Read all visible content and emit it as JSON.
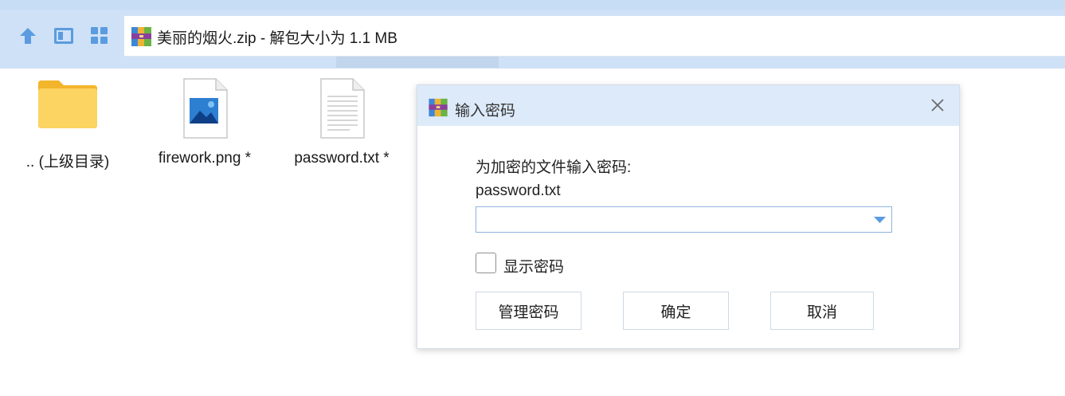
{
  "toolbar": {
    "nav_icons": [
      "up-arrow-icon",
      "view-icon",
      "grid-icon"
    ],
    "address_text": "美丽的烟火.zip - 解包大小为 1.1 MB",
    "archive_icon": "winrar-archive-icon"
  },
  "files": [
    {
      "name": ".. (上级目录)",
      "icon": "folder-icon"
    },
    {
      "name": "firework.png *",
      "icon": "image-file-icon"
    },
    {
      "name": "password.txt *",
      "icon": "text-file-icon"
    }
  ],
  "dialog": {
    "title": "输入密码",
    "prompt": "为加密的文件输入密码:",
    "filename": "password.txt",
    "password_value": "",
    "show_password_label": "显示密码",
    "show_password_checked": false,
    "buttons": {
      "manage": "管理密码",
      "ok": "确定",
      "cancel": "取消"
    }
  },
  "colors": {
    "toolbar_bg": "#cfe1f6",
    "dialog_title_bg": "#ddeafa",
    "accent": "#3a86d8",
    "folder": "#f7c844"
  }
}
